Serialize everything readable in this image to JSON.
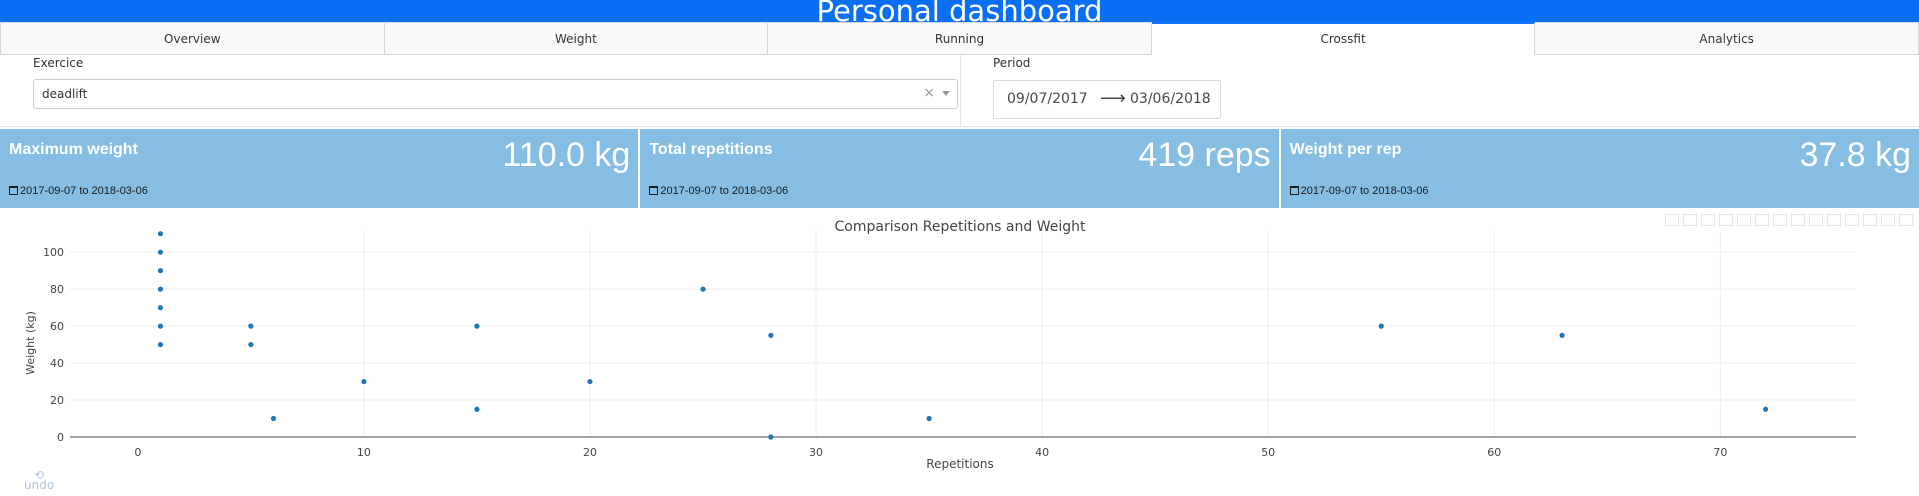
{
  "header": {
    "title": "Personal dashboard"
  },
  "tabs": [
    {
      "label": "Overview",
      "active": false
    },
    {
      "label": "Weight",
      "active": false
    },
    {
      "label": "Running",
      "active": false
    },
    {
      "label": "Crossfit",
      "active": true
    },
    {
      "label": "Analytics",
      "active": false
    }
  ],
  "controls": {
    "exercise_label": "Exercice",
    "exercise_value": "deadlift",
    "clear_symbol": "×",
    "period_label": "Period",
    "start_date": "09/07/2017",
    "end_date": "03/06/2018",
    "arrow_symbol": "⟶"
  },
  "cards": [
    {
      "title": "Maximum weight",
      "value": "110.0 kg",
      "date_range": "2017-09-07 to 2018-03-06"
    },
    {
      "title": "Total repetitions",
      "value": "419 reps",
      "date_range": "2017-09-07 to 2018-03-06"
    },
    {
      "title": "Weight per rep",
      "value": "37.8 kg",
      "date_range": "2017-09-07 to 2018-03-06"
    }
  ],
  "colors": {
    "header": "#0a6ff5",
    "card": "#85bde3",
    "marker": "#1f77b4"
  },
  "undo_label": "undo",
  "chart_data": {
    "type": "scatter",
    "title": "Comparison Repetitions and Weight",
    "xlabel": "Repetitions",
    "ylabel": "Weight (kg)",
    "xlim": [
      -3,
      76
    ],
    "ylim": [
      0,
      112
    ],
    "xticks": [
      0,
      10,
      20,
      30,
      40,
      50,
      60,
      70
    ],
    "yticks": [
      0,
      20,
      40,
      60,
      80,
      100
    ],
    "grid": true,
    "series": [
      {
        "x": [
          1,
          1,
          1,
          1,
          1,
          1,
          1,
          5,
          5,
          6,
          10,
          15,
          15,
          20,
          25,
          28,
          28,
          35,
          55,
          63,
          72
        ],
        "y": [
          110,
          100,
          90,
          80,
          70,
          60,
          50,
          60,
          50,
          10,
          30,
          60,
          15,
          30,
          80,
          55,
          0,
          10,
          60,
          55,
          15
        ]
      }
    ]
  }
}
